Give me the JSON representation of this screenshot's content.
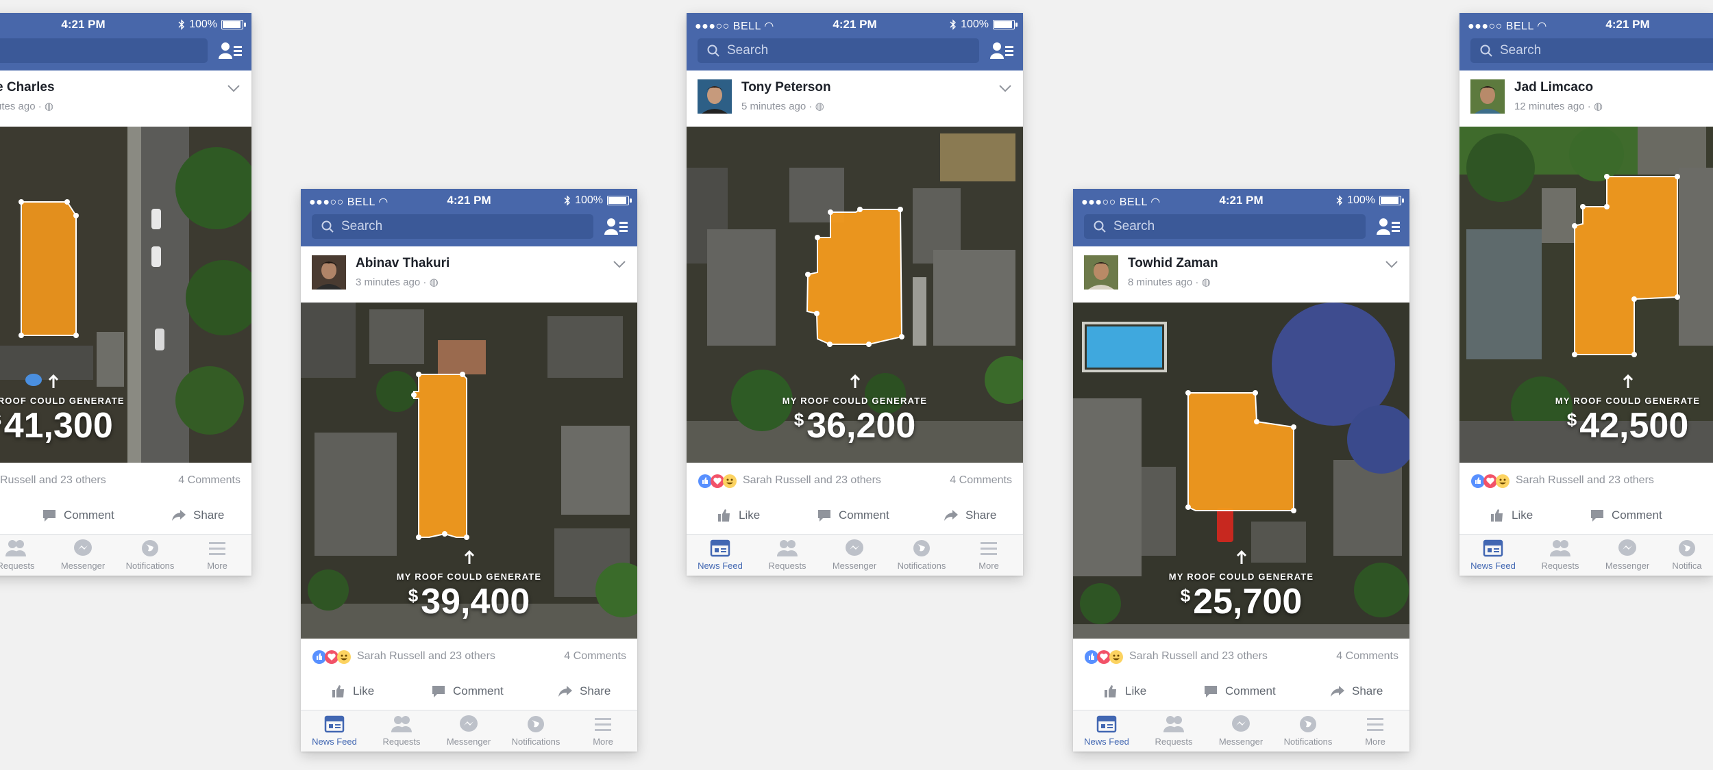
{
  "status": {
    "carrier": "●●●○○ BELL",
    "time": "4:21 PM",
    "battery": "100%"
  },
  "search": {
    "placeholder": "Search"
  },
  "roof_label": "MY ROOF COULD GENERATE",
  "currency": "$",
  "reactions": {
    "text": "Sarah Russell and 23 others",
    "partial_text": "Russell and 23 others",
    "comments": "4 Comments"
  },
  "actions": {
    "like": "Like",
    "comment": "Comment",
    "share": "Share"
  },
  "tabs": {
    "news_feed": "News Feed",
    "requests": "Requests",
    "messenger": "Messenger",
    "notifications": "Notifications",
    "more": "More",
    "notifications_partial": "Notifica"
  },
  "posts": [
    {
      "author": "Charles",
      "author_partial": "e Charles",
      "time": "utes ago",
      "amount": "41,300"
    },
    {
      "author": "Abinav Thakuri",
      "time": "3 minutes ago",
      "amount": "39,400"
    },
    {
      "author": "Tony Peterson",
      "time": "5 minutes ago",
      "amount": "36,200"
    },
    {
      "author": "Towhid Zaman",
      "time": "8 minutes ago",
      "amount": "25,700"
    },
    {
      "author": "Jad Limcaco",
      "time": "12 minutes ago",
      "amount": "42,500"
    }
  ],
  "colors": {
    "facebook_blue": "#4867aa",
    "search_bg": "#3b5998",
    "roof_orange": "#f39a1e",
    "active_tab": "#4267b2",
    "page_bg": "#f1f1f1"
  }
}
